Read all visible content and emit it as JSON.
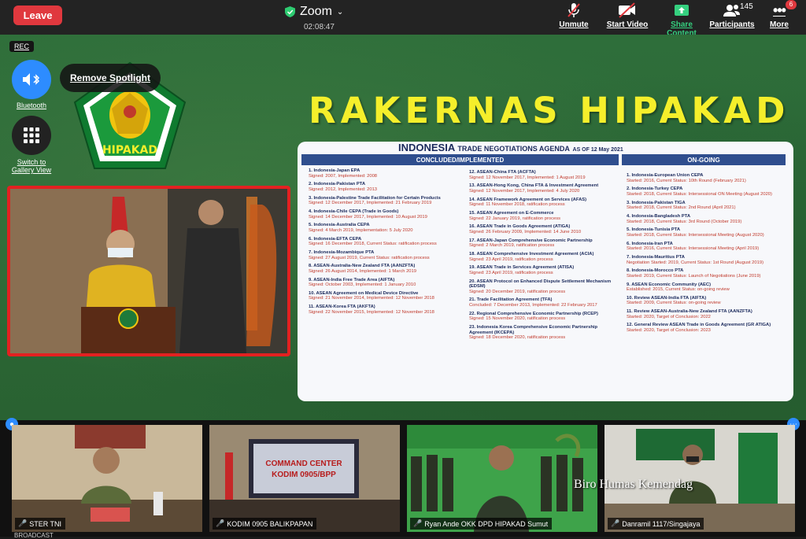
{
  "topbar": {
    "leave_label": "Leave",
    "app_title": "Zoom",
    "timer": "02:08:47",
    "unmute_label": "Unmute",
    "start_video_label": "Start Video",
    "share_label": "Share Content",
    "participants_label": "Participants",
    "participants_count": "145",
    "more_label": "More",
    "more_badge": "6"
  },
  "stage": {
    "rec_label": "REC",
    "bluetooth_label": "Bluetooth",
    "gallery_label": "Switch to Gallery View",
    "spotlight_label": "Remove Spotlight",
    "logo_text": "HIPAKAD",
    "headline": "RAKERNAS HIPAKAD",
    "board": {
      "title": "INDONESIA",
      "subtitle": "TRADE NEGOTIATIONS AGENDA",
      "asof": "AS OF 12 May 2021",
      "concluded_header": "CONCLUDED/IMPLEMENTED",
      "ongoing_header": "ON-GOING",
      "col1": [
        {
          "t": "1. Indonesia-Japan EPA",
          "d": "Signed: 2007, Implemented: 2008"
        },
        {
          "t": "2. Indonesia-Pakistan PTA",
          "d": "Signed: 2012, Implemented: 2013"
        },
        {
          "t": "3. Indonesia-Palestine Trade Facilitation for Certain Products",
          "d": "Signed: 12 December 2017, Implemented: 21 February 2019"
        },
        {
          "t": "4. Indonesia-Chile CEPA (Trade in Goods)",
          "d": "Signed: 14 December 2017, Implemented: 10 August 2019"
        },
        {
          "t": "5. Indonesia-Australia CEPA",
          "d": "Signed: 4 March 2019, Implementation: 5 July 2020"
        },
        {
          "t": "6. Indonesia-EFTA CEPA",
          "d": "Signed: 16 December 2018, Current Status: ratification process"
        },
        {
          "t": "7. Indonesia-Mozambique PTA",
          "d": "Signed: 27 August 2019, Current Status: ratification process"
        },
        {
          "t": "8. ASEAN-Australia-New Zealand FTA (AANZFTA)",
          "d": "Signed: 26 August 2014, Implemented: 1 March 2019"
        },
        {
          "t": "9. ASEAN-India Free Trade Area (AIFTA)",
          "d": "Signed: October 2003, Implemented: 1 January 2010"
        },
        {
          "t": "10. ASEAN Agreement on Medical Device Directive",
          "d": "Signed: 21 November 2014, Implemented: 12 November 2018"
        },
        {
          "t": "11. ASEAN-Korea FTA (AKFTA)",
          "d": "Signed: 22 November 2015, Implemented: 12 November 2018"
        }
      ],
      "col2": [
        {
          "t": "12. ASEAN-China FTA (ACFTA)",
          "d": "Signed: 12 November 2017, Implemented: 1 August 2019"
        },
        {
          "t": "13. ASEAN-Hong Kong, China FTA & Investment Agreement",
          "d": "Signed: 12 November 2017, Implemented: 4 July 2020"
        },
        {
          "t": "14. ASEAN Framework Agreement on Services (AFAS)",
          "d": "Signed: 11 November 2018, ratification process"
        },
        {
          "t": "15. ASEAN Agreement on E-Commerce",
          "d": "Signed: 22 January 2019, ratification process"
        },
        {
          "t": "16. ASEAN Trade in Goods Agreement (ATIGA)",
          "d": "Signed: 26 February 2009, Implemented: 14 June 2010"
        },
        {
          "t": "17. ASEAN-Japan Comprehensive Economic Partnership",
          "d": "Signed: 2 March 2019, ratification process"
        },
        {
          "t": "18. ASEAN Comprehensive Investment Agreement (ACIA)",
          "d": "Signed: 23 April 2019, ratification process"
        },
        {
          "t": "19. ASEAN Trade in Services Agreement (ATISA)",
          "d": "Signed: 23 April 2019, ratification process"
        },
        {
          "t": "20. ASEAN Protocol on Enhanced Dispute Settlement Mechanism (EDSM)",
          "d": "Signed: 20 December 2019, ratification process"
        },
        {
          "t": "21. Trade Facilitation Agreement (TFA)",
          "d": "Concluded: 7 December 2013, Implemented: 22 February 2017"
        },
        {
          "t": "22. Regional Comprehensive Economic Partnership (RCEP)",
          "d": "Signed: 15 November 2020, ratification process"
        },
        {
          "t": "23. Indonesia Korea Comprehensive Economic Partnership Agreement (IKCEPA)",
          "d": "Signed: 18 December 2020, ratification process"
        }
      ],
      "col3": [
        {
          "t": "1. Indonesia-European Union CEPA",
          "d": "Started: 2016, Current Status: 10th Round (February 2021)"
        },
        {
          "t": "2. Indonesia-Turkey CEPA",
          "d": "Started: 2018, Current Status: Intersessional ON Meeting (August 2020)"
        },
        {
          "t": "3. Indonesia-Pakistan TIGA",
          "d": "Started: 2018, Current Status: 2nd Round (April 2021)"
        },
        {
          "t": "4. Indonesia-Bangladesh PTA",
          "d": "Started: 2018, Current Status: 3rd Round (October 2019)"
        },
        {
          "t": "5. Indonesia-Tunisia PTA",
          "d": "Started: 2018, Current Status: Intersessional Meeting (August 2020)"
        },
        {
          "t": "6. Indonesia-Iran PTA",
          "d": "Started: 2016, Current Status: Intersessional Meeting (April 2019)"
        },
        {
          "t": "7. Indonesia-Mauritius PTA",
          "d": "Negotiation Started: 2019, Current Status: 1st Round (August 2019)"
        },
        {
          "t": "8. Indonesia-Morocco PTA",
          "d": "Started: 2019, Current Status: Launch of Negotiations (June 2019)"
        },
        {
          "t": "9. ASEAN Economic Community (AEC)",
          "d": "Established: 2015, Current Status: on-going review"
        },
        {
          "t": "10. Review ASEAN-India FTA (AIFTA)",
          "d": "Started: 2009, Current Status: on-going review"
        },
        {
          "t": "11. Review ASEAN-Australia-New Zealand FTA (AANZFTA)",
          "d": "Started: 2020, Target of Conclusion: 2022"
        },
        {
          "t": "12. General Review ASEAN Trade in Goods Agreement (GR ATIGA)",
          "d": "Started: 2020, Target of Conclusion: 2023"
        }
      ]
    }
  },
  "gallery": {
    "tiles": [
      {
        "label": "STER TNI"
      },
      {
        "label": "KODIM 0905 BALIKPAPAN"
      },
      {
        "label": "Ryan Ande OKK DPD HIPAKAD Sumut"
      },
      {
        "label": "Danramil 1117/Singajaya"
      }
    ],
    "tile2_screen_line1": "COMMAND CENTER",
    "tile2_screen_line2": "KODIM 0905/BPP",
    "watermark": "Biro Humas Kemendag",
    "broadcast_label": "BROADCAST"
  }
}
